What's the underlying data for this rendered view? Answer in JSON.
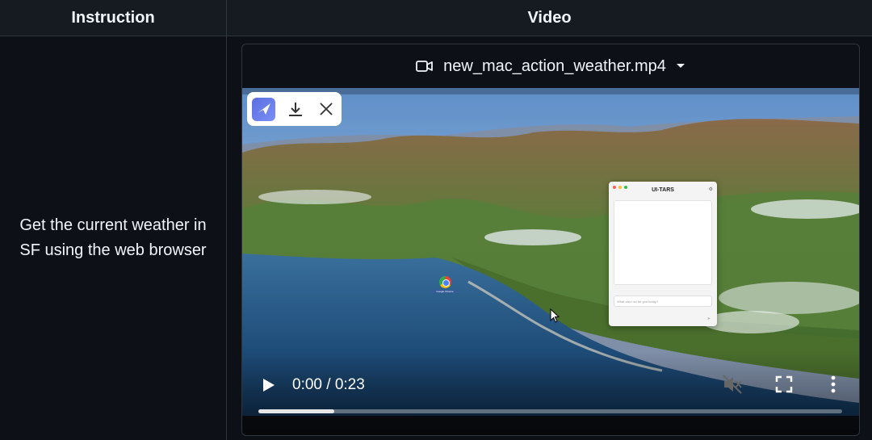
{
  "table": {
    "header_left": "Instruction",
    "header_right": "Video"
  },
  "instruction": {
    "text": "Get the current weather in SF using the web browser"
  },
  "video": {
    "file_name": "new_mac_action_weather.mp4",
    "icons": {
      "file": "video-camera-icon",
      "dropdown": "chevron-down-icon",
      "play": "play-icon",
      "mute": "speaker-muted-icon",
      "fullscreen": "fullscreen-icon",
      "more": "more-vertical-icon"
    },
    "time_display": "0:00 / 0:23",
    "progress_fraction": 0.13
  },
  "screen": {
    "overlay_icons": [
      "app-bird-icon",
      "download-icon",
      "close-icon"
    ],
    "agent_window": {
      "title": "UI-TARS",
      "input_placeholder": "What can I do for you today?"
    },
    "desktop_icon_label": "Google Chrome"
  },
  "colors": {
    "page_bg": "#0d1117",
    "header_bg": "#161b22",
    "border": "#30363d",
    "text": "#f0f6fc"
  }
}
